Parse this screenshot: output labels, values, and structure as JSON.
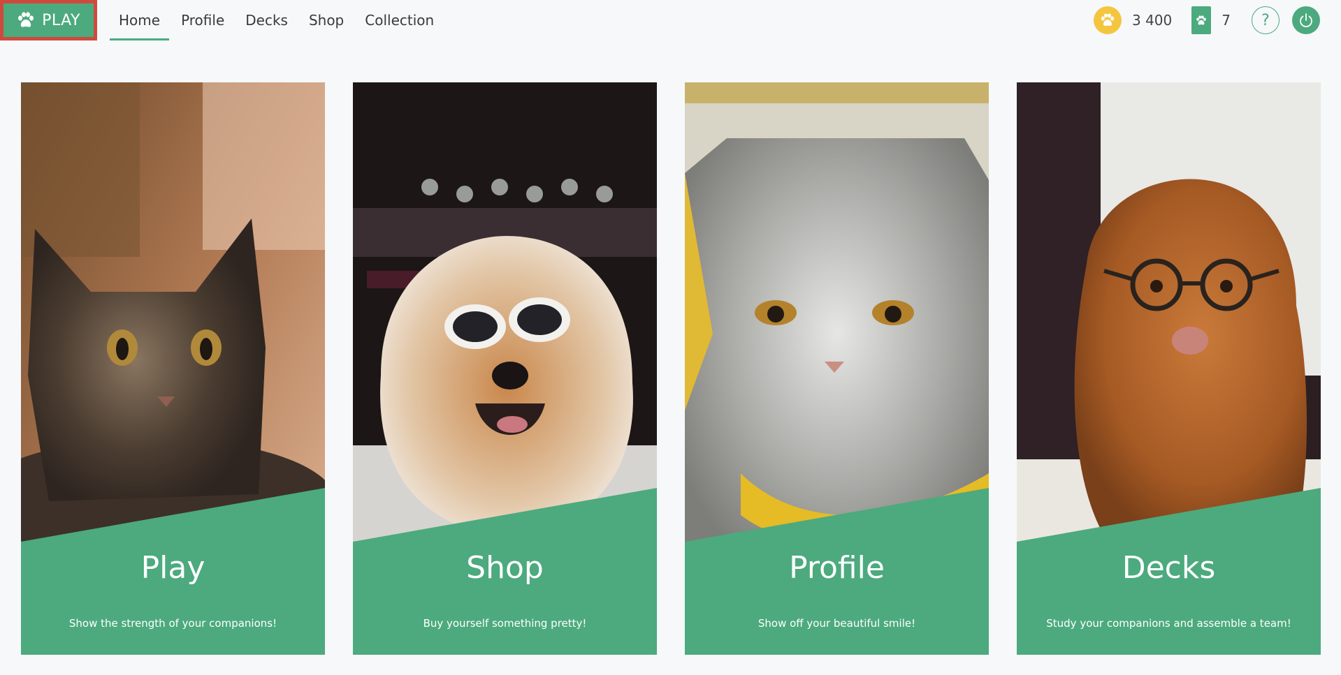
{
  "header": {
    "play_label": "PLAY",
    "play_icon": "paw-icon",
    "nav": [
      {
        "label": "Home",
        "active": true
      },
      {
        "label": "Profile",
        "active": false
      },
      {
        "label": "Decks",
        "active": false
      },
      {
        "label": "Shop",
        "active": false
      },
      {
        "label": "Collection",
        "active": false
      }
    ],
    "coins": "3 400",
    "cards": "7",
    "help_label": "?"
  },
  "tiles": [
    {
      "title": "Play",
      "description": "Show the strength of your companions!",
      "photo": "tabby cat lying down",
      "selected": true
    },
    {
      "title": "Shop",
      "description": "Buy yourself something pretty!",
      "photo": "chow chow dog with white sunglasses",
      "selected": false
    },
    {
      "title": "Profile",
      "description": "Show off your beautiful smile!",
      "photo": "grumpy grey cat with yellow scarf",
      "selected": false
    },
    {
      "title": "Decks",
      "description": "Study your companions and assemble a team!",
      "photo": "golden retriever with glasses",
      "selected": false
    }
  ],
  "colors": {
    "accent": "#4caa7e",
    "selection": "#cf4a3c",
    "coin": "#f4c63f",
    "background": "#f6f8fa"
  }
}
